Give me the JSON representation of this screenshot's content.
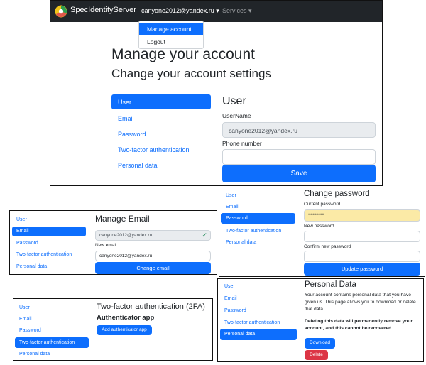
{
  "colors": {
    "navbar": "#212529",
    "primary": "#0d6efd",
    "danger": "#dc3545",
    "readonly": "#e9ecef",
    "autofill": "#fbeaa6"
  },
  "navbar": {
    "brand": "SpecIdentityServer",
    "user": "canyone2012@yandex.ru ▾",
    "services": "Services ▾"
  },
  "dropdown": {
    "items": [
      "Manage account",
      "Logout"
    ]
  },
  "main": {
    "title": "Manage your account",
    "subtitle": "Change your account settings",
    "nav": [
      "User",
      "Email",
      "Password",
      "Two-factor authentication",
      "Personal data"
    ],
    "heading": "User",
    "username_label": "UserName",
    "username_value": "canyone2012@yandex.ru",
    "phone_label": "Phone number",
    "phone_value": "",
    "save": "Save"
  },
  "email_panel": {
    "nav": [
      "User",
      "Email",
      "Password",
      "Two-factor authentication",
      "Personal data"
    ],
    "heading": "Manage Email",
    "current": "canyone2012@yandex.ru",
    "check": "✓",
    "new_label": "New email",
    "new_value": "canyone2012@yandex.ru",
    "button": "Change email"
  },
  "password_panel": {
    "nav": [
      "User",
      "Email",
      "Password",
      "Two-factor authentication",
      "Personal data"
    ],
    "heading": "Change password",
    "current_label": "Current password",
    "current_value": "••••••••••••••",
    "new_label": "New password",
    "confirm_label": "Confirm new password",
    "button": "Update password"
  },
  "twofa_panel": {
    "nav": [
      "User",
      "Email",
      "Password",
      "Two-factor authentication",
      "Personal data"
    ],
    "heading": "Two-factor authentication (2FA)",
    "subheading": "Authenticator app",
    "button": "Add authenticator app"
  },
  "personal_panel": {
    "nav": [
      "User",
      "Email",
      "Password",
      "Two-factor authentication",
      "Personal data"
    ],
    "heading": "Personal Data",
    "text": "Your account contains personal data that you have given us. This page allows you to download or delete that data.",
    "warning": "Deleting this data will permanently remove your account, and this cannot be recovered.",
    "download": "Download",
    "delete": "Delete"
  }
}
